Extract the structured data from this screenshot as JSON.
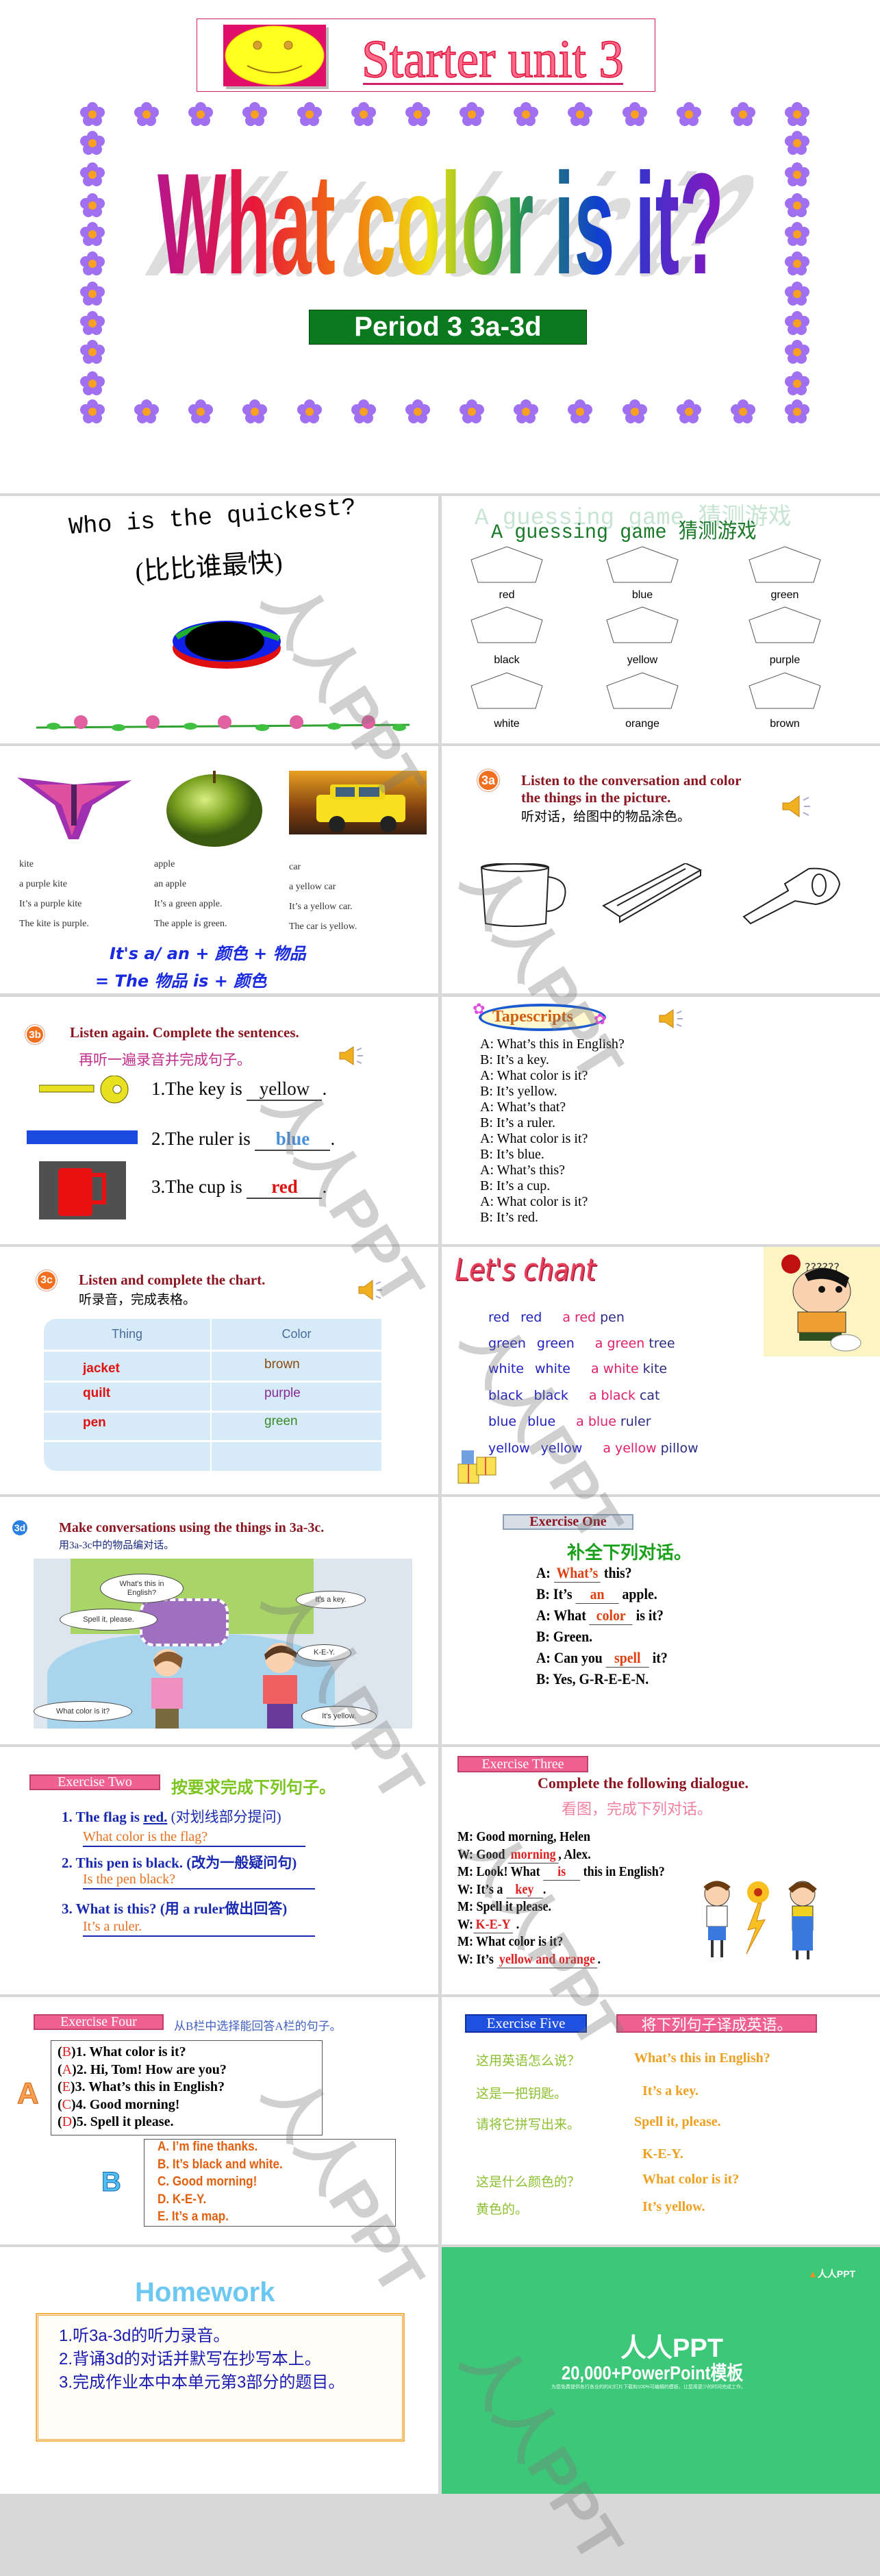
{
  "title_slide": {
    "unit": "Starter unit 3",
    "title": "What color is it?",
    "period": "Period 3 3a-3d"
  },
  "quickest": {
    "title": "Who is the quickest?",
    "subtitle": "(比比谁最快)"
  },
  "guessing": {
    "title": "A guessing game 猜测游戏",
    "colors": [
      "red",
      "blue",
      "green",
      "black",
      "yellow",
      "purple",
      "white",
      "orange",
      "brown"
    ]
  },
  "vocab": {
    "items": [
      {
        "word": "kite",
        "phrase": "a purple kite",
        "sentence1": "It’s a purple kite",
        "sentence2": "The kite is purple."
      },
      {
        "word": "apple",
        "phrase": "an apple",
        "sentence1": "It’s a green apple.",
        "sentence2": "The apple is green."
      },
      {
        "word": "car",
        "phrase": "a yellow car",
        "sentence1": "It’s a yellow car.",
        "sentence2": "The car is yellow."
      }
    ],
    "formula1": "It's a/ an + 颜色 + 物品",
    "formula2": "= The 物品 is + 颜色"
  },
  "s3a": {
    "badge": "3a",
    "instruction": "Listen to the conversation and color",
    "instruction2": "the things in the picture.",
    "instruction_cn": "听对话，给图中的物品涂色。"
  },
  "s3b": {
    "badge": "3b",
    "instruction": "Listen again. Complete the sentences.",
    "instruction_cn": "再听一遍录音并完成句子。",
    "sentences": [
      {
        "prefix": "1.The key is ",
        "answer": "yellow",
        "suffix": ".",
        "answer_color": "#111111"
      },
      {
        "prefix": "2.The ruler is ",
        "answer": "blue",
        "suffix": ".",
        "answer_color": "#4a90d9"
      },
      {
        "prefix": "3.The cup is ",
        "answer": "red",
        "suffix": ".",
        "answer_color": "#e01010"
      }
    ]
  },
  "tapescripts": {
    "title": "Tapescripts",
    "lines": [
      "A: What’s this in English?",
      "B: It’s a key.",
      "A: What color is it?",
      "B: It’s yellow.",
      "A: What’s that?",
      "B: It’s a ruler.",
      "A: What color is it?",
      "B: It’s blue.",
      "A: What’s this?",
      "B: It’s a cup.",
      "A: What color is it?",
      "B: It’s red."
    ]
  },
  "s3c": {
    "badge": "3c",
    "instruction": "Listen and complete the chart.",
    "instruction_cn": "听录音，完成表格。",
    "headers": [
      "Thing",
      "Color"
    ],
    "rows": [
      {
        "thing": "jacket",
        "color": "brown",
        "color_hex": "#8a4a10"
      },
      {
        "thing": "quilt",
        "color": "purple",
        "color_hex": "#8a2a9a"
      },
      {
        "thing": "pen",
        "color": "green",
        "color_hex": "#3a8a2a"
      }
    ]
  },
  "chant": {
    "title": "Let's chant",
    "lines": [
      [
        "red",
        "red",
        "a",
        "red",
        "pen"
      ],
      [
        "green",
        "green",
        "a",
        "green",
        "tree"
      ],
      [
        "white",
        "white",
        "a",
        "white",
        "kite"
      ],
      [
        "black",
        "black",
        "a",
        "black",
        "cat"
      ],
      [
        "blue",
        "blue",
        "a",
        "blue",
        "ruler"
      ],
      [
        "yellow",
        "yellow",
        "a",
        "yellow",
        "pillow"
      ]
    ]
  },
  "s3d": {
    "badge": "3d",
    "instruction": "Make conversations using the things in 3a-3c.",
    "instruction_cn": "用3a-3c中的物品编对话。",
    "bubbles": [
      "What's this in English?",
      "It's a key.",
      "Spell it, please.",
      "K-E-Y.",
      "What color is it?",
      "It's yellow."
    ]
  },
  "ex1": {
    "label": "Exercise One",
    "instruction": "补全下列对话。",
    "lines": [
      {
        "before": "A: ",
        "answer": "What’s",
        "after": " this?"
      },
      {
        "before": "B: It’s ",
        "answer": "an",
        "after": " apple."
      },
      {
        "before": "A: What ",
        "answer": "color",
        "after": " is it?"
      },
      {
        "before": "B: Green.",
        "answer": "",
        "after": ""
      },
      {
        "before": "A: Can you ",
        "answer": "spell",
        "after": " it?"
      },
      {
        "before": "B: Yes, G-R-E-E-N.",
        "answer": "",
        "after": ""
      }
    ]
  },
  "ex2": {
    "label": "Exercise Two",
    "instruction": "按要求完成下列句子。",
    "items": [
      {
        "q_before": "1. The flag is ",
        "q_underlined": "red.",
        "q_after": " (对划线部分提问)",
        "answer": "What color is the flag?"
      },
      {
        "q_before": "2. This pen is black. (改为一般疑问句)",
        "q_underlined": "",
        "q_after": "",
        "answer": "Is the pen black?"
      },
      {
        "q_before": "3. What is this? (用 a ruler做出回答)",
        "q_underlined": "",
        "q_after": "",
        "answer": "It’s a ruler."
      }
    ]
  },
  "ex3": {
    "label": "Exercise Three",
    "instruction": "Complete the following dialogue.",
    "instruction_cn": "看图，完成下列对话。",
    "lines": [
      {
        "before": "M: Good morning, Helen",
        "answer": "",
        "after": ""
      },
      {
        "before": "W: Good ",
        "answer": "morning",
        "after": ", Alex."
      },
      {
        "before": "M: Look! What ",
        "answer": "is",
        "after": " this in English?"
      },
      {
        "before": "W: It’s a ",
        "answer": "key",
        "after": "."
      },
      {
        "before": "M: Spell it please.",
        "answer": "",
        "after": ""
      },
      {
        "before": "W:",
        "answer": "K-E-Y",
        "after": " ."
      },
      {
        "before": "M: What color is it?",
        "answer": "",
        "after": ""
      },
      {
        "before": "W: It’s ",
        "answer": "yellow and orange",
        "after": "."
      }
    ]
  },
  "ex4": {
    "label": "Exercise Four",
    "instruction": "从B栏中选择能回答A栏的句子。",
    "column_a_label": "A",
    "column_b_label": "B",
    "questions": [
      {
        "answer": "B",
        "text": "1. What color is it?"
      },
      {
        "answer": "A",
        "text": "2. Hi, Tom! How are you?"
      },
      {
        "answer": "E",
        "text": "3. What’s this in English?"
      },
      {
        "answer": "C",
        "text": "4. Good morning!"
      },
      {
        "answer": "D",
        "text": "5. Spell it please."
      }
    ],
    "options": [
      "A. I’m fine thanks.",
      "B. It’s black and white.",
      "C. Good morning!",
      "D. K-E-Y.",
      "E. It’s a map."
    ]
  },
  "ex5": {
    "label": "Exercise Five",
    "instruction": "将下列句子译成英语。",
    "pairs": [
      {
        "cn": "这用英语怎么说？",
        "en": "What’s this in English?"
      },
      {
        "cn": "这是一把钥匙。",
        "en": "It’s a key."
      },
      {
        "cn": "请将它拼写出来。",
        "en": "Spell it, please."
      },
      {
        "cn": "",
        "en": "K-E-Y."
      },
      {
        "cn": "这是什么颜色的？",
        "en": "What color is it?"
      },
      {
        "cn": "黄色的。",
        "en": "It’s yellow."
      }
    ]
  },
  "homework": {
    "title": "Homework",
    "items": [
      "1.听3a-3d的听力录音。",
      "2.背诵3d的对话并默写在抄写本上。",
      "3.完成作业本中本单元第3部分的题目。"
    ]
  },
  "ending": {
    "logo": "人人PPT",
    "title": "人人PPT",
    "subtitle": "20,000+PowerPoint模板",
    "tagline": "为您免费提供各行各业的的幻灯片下载和100%可编辑的模板，让您用更少的时间完成工作。",
    "bg_color": "#3cc878"
  },
  "watermark": "人人PPT",
  "colors": {
    "instruction_red": "#8b1520",
    "answer_red": "#e02020",
    "exercise_pink": "#f06090",
    "exercise_blue": "#2050e0"
  }
}
